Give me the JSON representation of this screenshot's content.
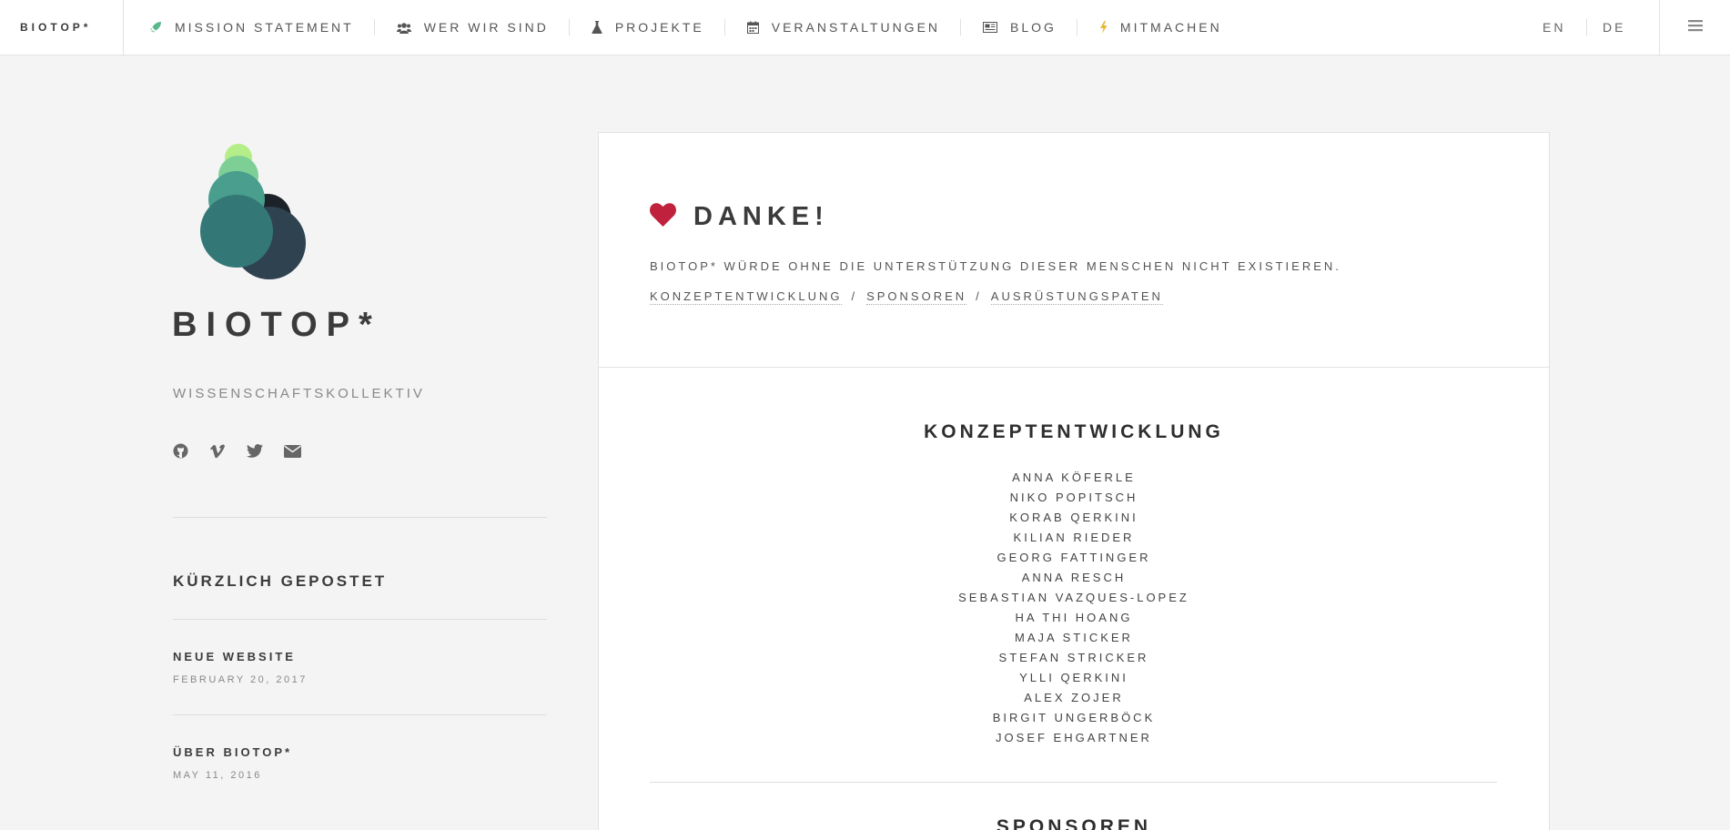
{
  "header": {
    "brand": "BIOTOP*",
    "nav": [
      {
        "label": "MISSION STATEMENT",
        "icon": "rocket-icon"
      },
      {
        "label": "WER WIR SIND",
        "icon": "users-icon"
      },
      {
        "label": "PROJEKTE",
        "icon": "flask-icon"
      },
      {
        "label": "VERANSTALTUNGEN",
        "icon": "calendar-icon"
      },
      {
        "label": "BLOG",
        "icon": "newspaper-icon"
      },
      {
        "label": "MITMACHEN",
        "icon": "bolt-icon"
      }
    ],
    "languages": [
      "EN",
      "DE"
    ],
    "menu_icon": "hamburger-icon"
  },
  "colors": {
    "accent_green": "#5bb88a",
    "bolt_yellow": "#e8b832",
    "heart_red": "#c0213d",
    "logo_light_green": "#b5ee88",
    "logo_green": "#7dcf96",
    "logo_teal": "#4a9e8e",
    "logo_dark_teal": "#337777",
    "logo_navy": "#2e4250",
    "logo_black": "#1d2128"
  },
  "sidebar": {
    "title": "BIOTOP*",
    "subtitle": "WISSENSCHAFTSKOLLEKTIV",
    "social": [
      "github-icon",
      "vimeo-icon",
      "twitter-icon",
      "envelope-icon"
    ],
    "recent_title": "KÜRZLICH GEPOSTET",
    "posts": [
      {
        "title": "NEUE WEBSITE",
        "date": "FEBRUARY 20, 2017"
      },
      {
        "title": "ÜBER BIOTOP*",
        "date": "MAY 11, 2016"
      }
    ]
  },
  "main": {
    "heading": "DANKE!",
    "heading_icon": "heart-icon",
    "intro": "BIOTOP* WÜRDE OHNE DIE UNTERSTÜTZUNG DIESER MENSCHEN NICHT EXISTIEREN.",
    "links": [
      "KONZEPTENTWICKLUNG",
      "SPONSOREN",
      "AUSRÜSTUNGSPATEN"
    ],
    "link_separator": "/",
    "sections": [
      {
        "title": "KONZEPTENTWICKLUNG",
        "names": [
          "ANNA KÖFERLE",
          "NIKO POPITSCH",
          "KORAB QERKINI",
          "KILIAN RIEDER",
          "GEORG FATTINGER",
          "ANNA RESCH",
          "SEBASTIAN VAZQUES-LOPEZ",
          "HA THI HOANG",
          "MAJA STICKER",
          "STEFAN STRICKER",
          "YLLI QERKINI",
          "ALEX ZOJER",
          "BIRGIT UNGERBÖCK",
          "JOSEF EHGARTNER"
        ]
      },
      {
        "title": "SPONSOREN"
      }
    ]
  }
}
